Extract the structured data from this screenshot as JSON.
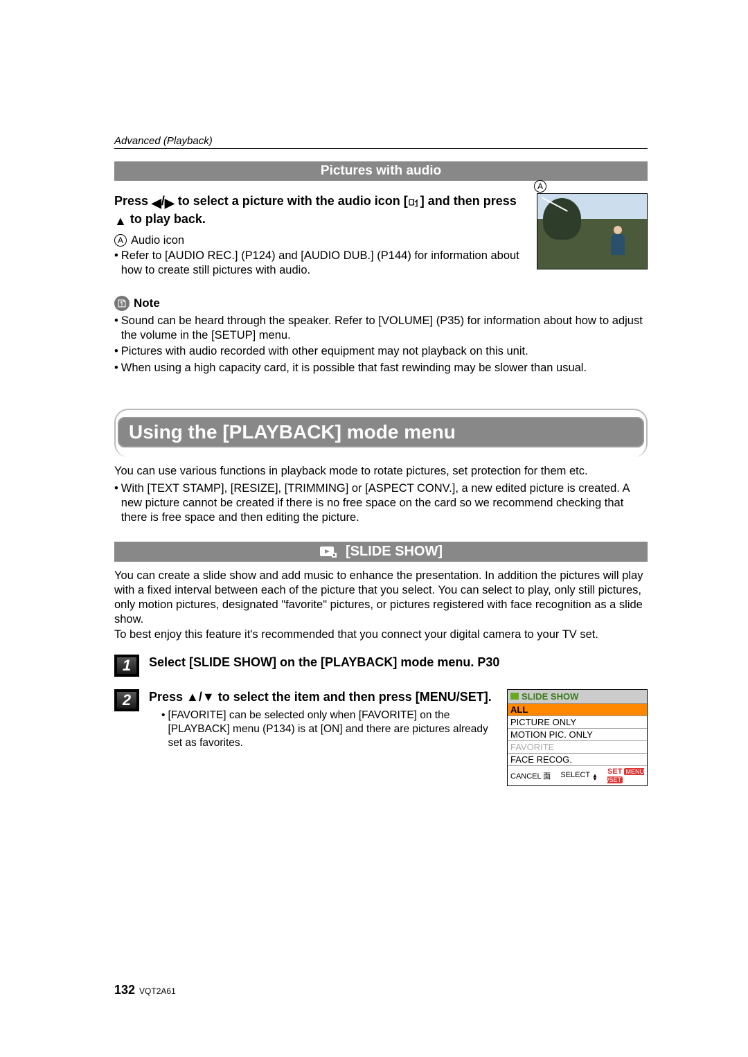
{
  "header": {
    "breadcrumb": "Advanced (Playback)"
  },
  "section1": {
    "title": "Pictures with audio",
    "instruction_pre": "Press ",
    "instruction_mid": " to select a picture with the audio icon [",
    "instruction_post": "] and then press ",
    "instruction_end": " to play back.",
    "legend_label": "Audio icon",
    "bullet1": "Refer to [AUDIO REC.] (P124) and [AUDIO DUB.] (P144) for information about how to create still pictures with audio.",
    "note_label": "Note",
    "note_bullets": [
      "Sound can be heard through the speaker. Refer to [VOLUME] (P35) for information about how to adjust the volume in the [SETUP] menu.",
      "Pictures with audio recorded with other equipment may not playback on this unit.",
      "When using a high capacity card, it is possible that fast rewinding may be slower than usual."
    ]
  },
  "banner": {
    "title": "Using the [PLAYBACK] mode menu"
  },
  "after_banner": {
    "para1": "You can use various functions in playback mode to rotate pictures, set protection for them etc.",
    "bullet": "With [TEXT STAMP], [RESIZE], [TRIMMING] or [ASPECT CONV.], a new edited picture is created. A new picture cannot be created if there is no free space on the card so we recommend checking that there is free space and then editing the picture."
  },
  "slide": {
    "title": "[SLIDE SHOW]",
    "para1": "You can create a slide show and add music to enhance the presentation. In addition the pictures will play with a fixed interval between each of the picture that you select. You can select to play, only still pictures, only motion pictures, designated \"favorite\" pictures, or pictures registered with face recognition as a slide show.",
    "para2": "To best enjoy this feature it's recommended that you connect your digital camera to your TV set.",
    "step1_num": "1",
    "step1_text": "Select [SLIDE SHOW] on the [PLAYBACK] mode menu. P30",
    "step2_num": "2",
    "step2_line1_pre": "Press ",
    "step2_line1_post": " to select the item and then press [MENU/SET].",
    "step2_bullet": "[FAVORITE] can be selected only when [FAVORITE] on the [PLAYBACK] menu (P134) is at [ON] and there are pictures already set as favorites."
  },
  "lcd": {
    "header": "SLIDE SHOW",
    "rows": [
      "ALL",
      "PICTURE ONLY",
      "MOTION PIC. ONLY",
      "FAVORITE",
      "FACE RECOG."
    ],
    "footer_cancel": "CANCEL",
    "footer_select": "SELECT",
    "footer_set": "SET"
  },
  "footer": {
    "page": "132",
    "doc": "VQT2A61"
  },
  "callout_letter": "A"
}
